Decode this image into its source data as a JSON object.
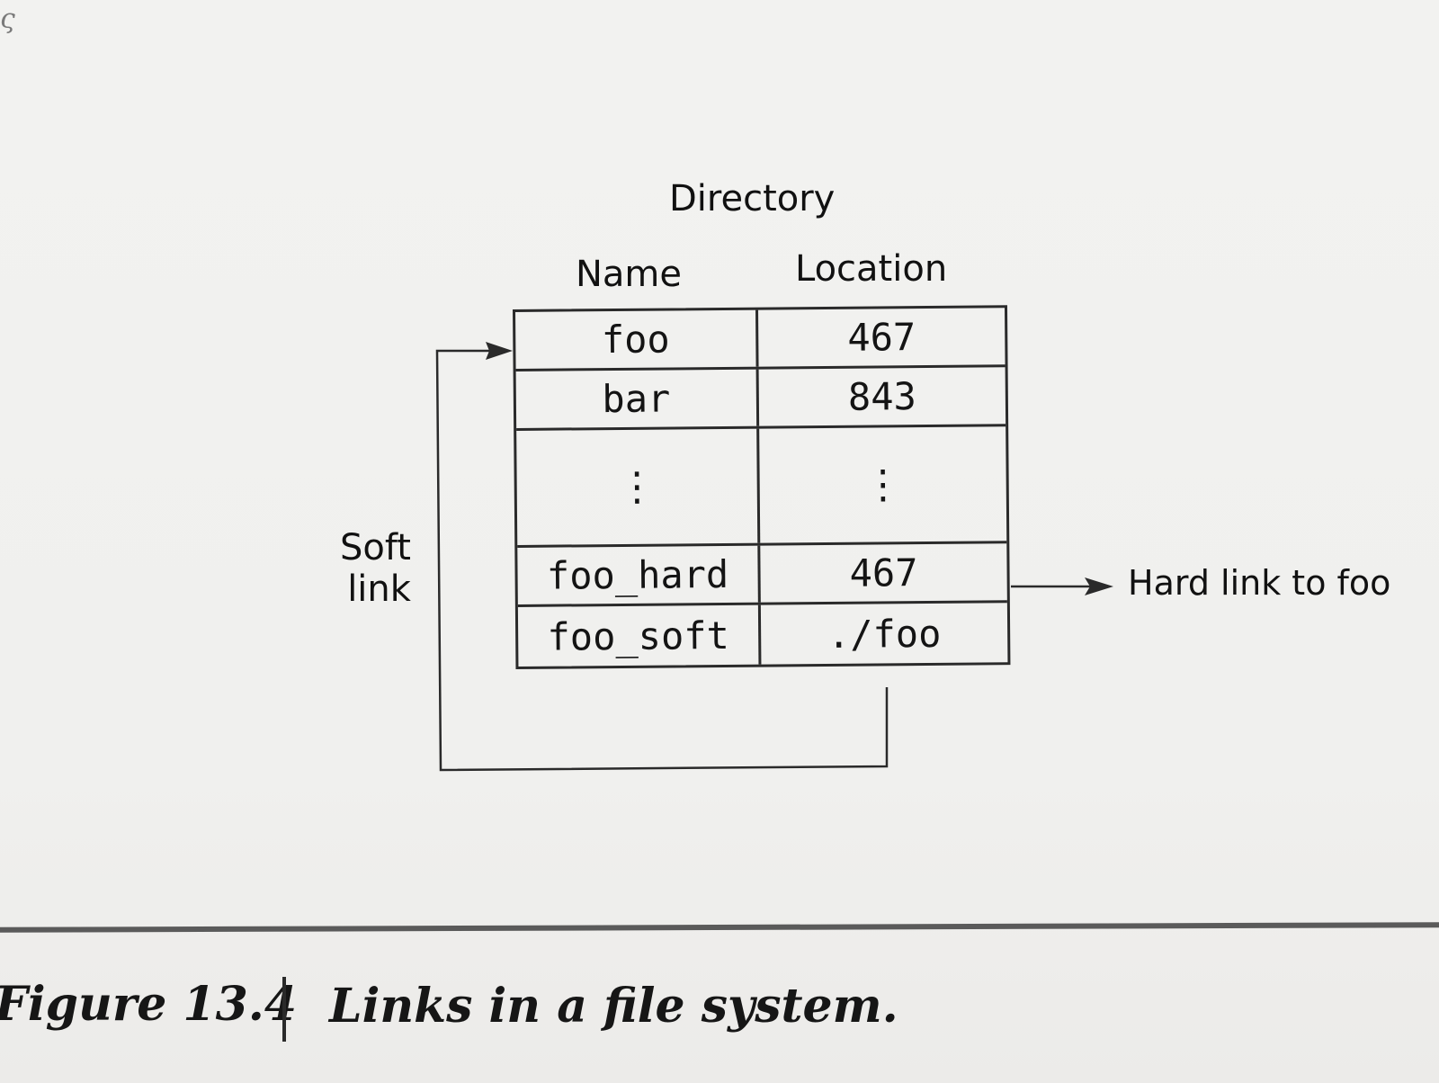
{
  "directory": {
    "title": "Directory",
    "columns": {
      "name": "Name",
      "location": "Location"
    },
    "rows": [
      {
        "name": "foo",
        "location": "467"
      },
      {
        "name": "bar",
        "location": "843"
      },
      {
        "name": "⋮",
        "location": "⋮"
      },
      {
        "name": "foo_hard",
        "location": "467"
      },
      {
        "name": "foo_soft",
        "location": "./foo"
      }
    ]
  },
  "annotations": {
    "soft_link_line1": "Soft",
    "soft_link_line2": "link",
    "hard_link": "Hard link to foo"
  },
  "caption": {
    "number": "Figure 13.4",
    "text": "Links in a file system."
  }
}
